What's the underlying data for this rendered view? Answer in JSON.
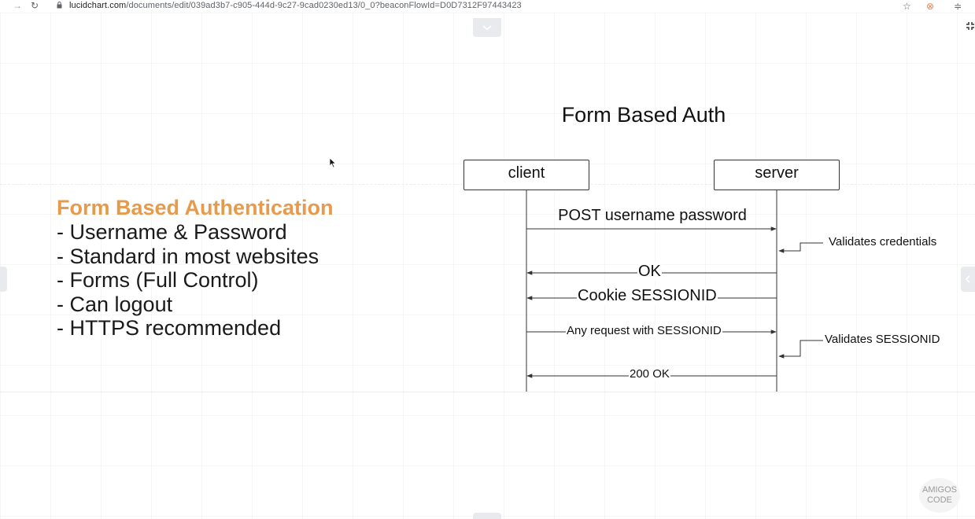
{
  "browser": {
    "back_glyph": "→",
    "reload_glyph": "↻",
    "url_host": "lucidchart.com",
    "url_path": "/documents/edit/039ad3b7-c905-444d-9c27-9cad0230ed13/0_0?beaconFlowId=D0D7312F97443423",
    "star_glyph": "☆",
    "ext_glyph": "⊗",
    "menu_glyph": "≑"
  },
  "slide": {
    "heading": "Form Based Authentication",
    "bullets": [
      "- Username & Password",
      "- Standard in most websites",
      "- Forms (Full Control)",
      "- Can logout",
      "- HTTPS recommended"
    ]
  },
  "diagram": {
    "title": "Form Based Auth",
    "client_label": "client",
    "server_label": "server",
    "messages": [
      "POST username password",
      "OK",
      "Cookie SESSIONID",
      "Any request with SESSIONID",
      "200 OK"
    ],
    "notes": [
      "Validates credentials",
      "Validates SESSIONID"
    ]
  },
  "logo": {
    "line1": "AMIGOS",
    "line2": "CODE"
  },
  "colors": {
    "heading_accent": "#e69a4c",
    "text": "#1a1a1a",
    "line": "#333333"
  }
}
